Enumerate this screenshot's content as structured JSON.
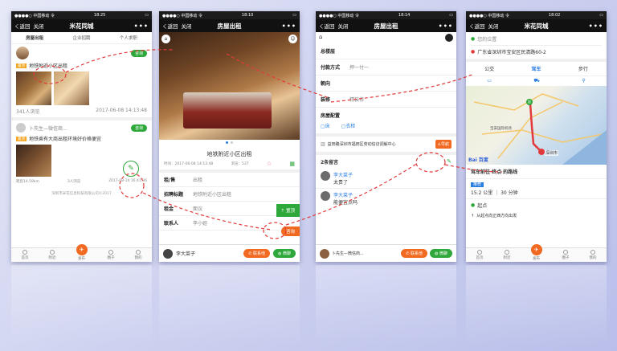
{
  "p1": {
    "status_carrier": "●●●●○ 中国移动 令",
    "status_time": "18:25",
    "status_battery": "▭",
    "back": "く返回",
    "close": "关闭",
    "title": "米花同城",
    "more": "•••",
    "tabs": [
      "房屋出租",
      "企业招聘",
      "个人求职"
    ],
    "post1_badge": "置顶",
    "post1_text": "地铁附近小区出租",
    "post1_consult": "咨询",
    "post1_views": "341人浏览",
    "post1_date": "2017-06-08 14:13:48",
    "post2_user": "卜先生—微信商...",
    "post2_badge": "置顶",
    "post2_text": "地铁乘有大商出租环境好价格便宜",
    "post2_consult": "咨询",
    "post2_distance": "距您14.59km",
    "post2_views": "3人浏览",
    "post2_date": "2017-08-14 16:41:36",
    "footer": "深圳市米花信息科技有限公司©2017",
    "nav": [
      "首页",
      "附近",
      "发布",
      "圈子",
      "我的"
    ]
  },
  "p2": {
    "status_carrier": "●●●●○ 中国移动 令",
    "status_time": "18:10",
    "back": "く返回",
    "close": "关闭",
    "title": "房屋出租",
    "more": "•••",
    "listing_title": "地铁附近小区出租",
    "meta_time": "时间：2017-06-08 14:13:48",
    "meta_views": "浏览：537",
    "field_rent_label": "租/售",
    "field_rent_value": "出租",
    "field_title_label": "招聘标题",
    "field_title_value": "地铁附近小区出租",
    "field_price_label": "租金",
    "field_price_value": "面议",
    "field_contact_label": "联系人",
    "field_contact_value": "李小姐",
    "top_btn": "置顶",
    "consult_btn": "咨询",
    "poster": "李大菜子",
    "call_btn": "联系他",
    "wechat_btn": "微聊"
  },
  "p3": {
    "status_carrier": "●●●●○ 中国移动 令",
    "status_time": "18:14",
    "back": "く返回",
    "close": "关闭",
    "title": "房屋出租",
    "more": "•••",
    "floors_label": "总楼层",
    "pay_label": "付款方式",
    "pay_value": "押一付一",
    "orient_label": "朝向",
    "deco_label": "装修",
    "deco_value": "精装修",
    "config_label": "房屋配置",
    "config_bed": "床",
    "config_wardrobe": "衣柜",
    "address": "益田路深圳市福田区劳动信访调解中心",
    "nav_btn": "导航",
    "comments_count": "2条留言",
    "c1_user": "李大菜子",
    "c1_text": "太贵了",
    "c2_user": "李大菜子",
    "c2_text": "能便宜点吗",
    "poster": "卜先生—微信商...",
    "call_btn": "联系他",
    "wechat_btn": "微聊"
  },
  "p4": {
    "status_carrier": "●●●●○ 中国移动 令",
    "status_time": "18:02",
    "back": "く返回",
    "close": "关闭",
    "title": "米花同城",
    "more": "•••",
    "my_location": "您的位置",
    "destination": "广东省深圳市宝安区民清路60-2",
    "modes": [
      "公交",
      "驾车",
      "步行"
    ],
    "map_city": "深圳市",
    "map_place": "宝安国际机场",
    "baidu": "Bai 百度",
    "route_title": "驾车前往 终点 的路线",
    "recommend": "推荐",
    "route_summary": "15.2 公里 ｜ 30 分钟",
    "start_label": "起点",
    "step1": "从起点向正西方向出发",
    "nav": [
      "首页",
      "附近",
      "发布",
      "圈子",
      "我的"
    ]
  }
}
